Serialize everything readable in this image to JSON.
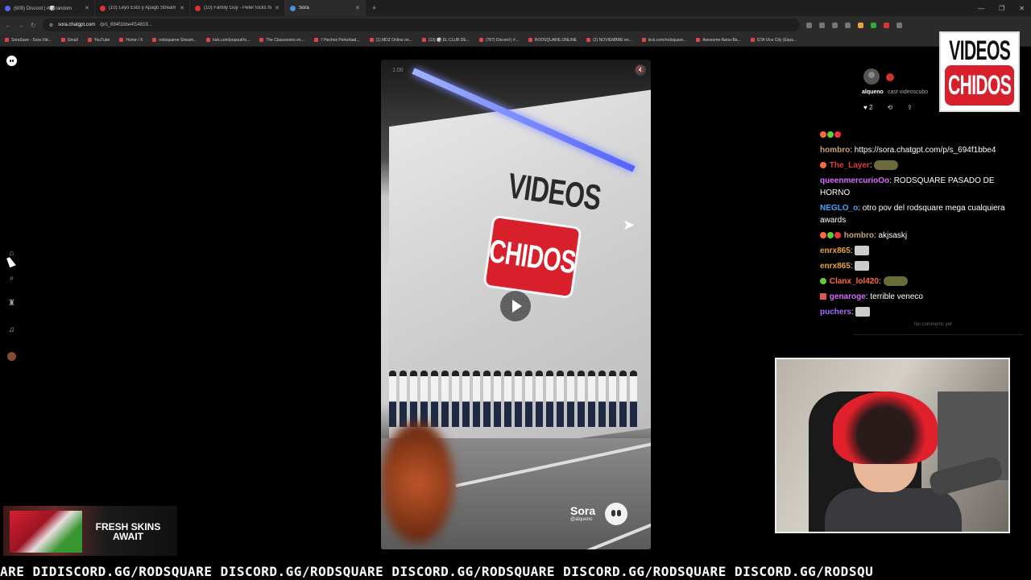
{
  "browser": {
    "tabs": [
      {
        "label": "(609) Discord | #🎲random",
        "icon": "discord"
      },
      {
        "label": "(10) Leyó Esto y Apagó Stream",
        "icon": "youtube"
      },
      {
        "label": "(10) Family Guy - Peter locks hi",
        "icon": "youtube"
      },
      {
        "label": "Sora",
        "icon": "sora"
      }
    ],
    "url_host": "sora.chatgpt.com",
    "url_path": "/p/s_694f1bbe4f14819...",
    "bookmarks": [
      "SoraSave - Sora Vid...",
      "Gmail",
      "YouTube",
      "Home / X",
      "rodsquaree Stream...",
      "kick.com/popout/ro...",
      "The Classrooms en...",
      "7 Hechos Perturbad...",
      "(1) MDZ Online on...",
      "(13) 🎲 EL CLUB DE...",
      "(787) Discord | #...",
      "RODSQUARE.ONLINE",
      "(2) NOVIEMBRE en...",
      "kick.com/rodsquare...",
      "Awesome-Nano-Ba...",
      "GTA Vice City (Espa..."
    ]
  },
  "video": {
    "time": "1:00",
    "sign_top": "VIDEOS",
    "sign_bottom": "CHIDOS",
    "watermark_name": "Sora",
    "watermark_handle": "@alqueno"
  },
  "post": {
    "username": "alqueno",
    "description": "cast videoscubo",
    "likes": "2"
  },
  "overlay_logo": {
    "top": "VIDEOS",
    "bottom": "CHIDOS"
  },
  "chat": [
    {
      "user": "",
      "color": "#ff6a3d",
      "text": "",
      "badges": 3
    },
    {
      "user": "hombro",
      "color": "#c9a37a",
      "text": ": https://sora.chatgpt.com/p/s_694f1bbe4"
    },
    {
      "user": "The_Layer",
      "color": "#e33b3b",
      "text": ":",
      "emote": "turtle"
    },
    {
      "user": "queenmercurioOo",
      "color": "#d86bff",
      "text": ": RODSQUARE PASADO DE HORNO"
    },
    {
      "user": "NEGLO_o",
      "color": "#3ea6ff",
      "text": ": otro pov del rodsquare mega cualquiera awards"
    },
    {
      "user": "hombro",
      "color": "#c9a37a",
      "text": ": akjsaskj"
    },
    {
      "user": "enrx865",
      "color": "#e8a33a",
      "text": ":",
      "emote": "img"
    },
    {
      "user": "enrx865",
      "color": "#e8a33a",
      "text": ":",
      "emote": "img"
    },
    {
      "user": "Clanx_lol420",
      "color": "#ff6a3d",
      "text": ":",
      "emote": "turtle"
    },
    {
      "user": "genaroge",
      "color": "#d86bff",
      "text": ": terrible veneco"
    },
    {
      "user": "puchers",
      "color": "#a36bff",
      "text": ":",
      "emote": "img"
    }
  ],
  "no_comments": "No comments yet",
  "ad": {
    "text": "FRESH SKINS AWAIT"
  },
  "ticker": "ARE DIDISCORD.GG/RODSQUARE DISCORD.GG/RODSQUARE DISCORD.GG/RODSQUARE DISCORD.GG/RODSQUARE DISCORD.GG/RODSQU"
}
